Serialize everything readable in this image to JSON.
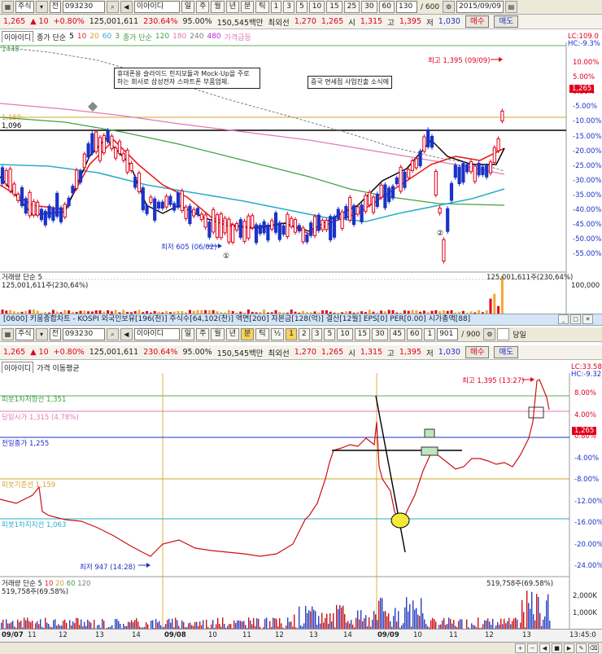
{
  "top_toolbar": {
    "market": "주식",
    "market_type": "전",
    "code": "093230",
    "name": "이아이디",
    "periods": [
      "일",
      "주",
      "월",
      "년",
      "분",
      "틱"
    ],
    "minute_buttons": [
      "1",
      "3",
      "5",
      "10",
      "15",
      "25",
      "30",
      "60"
    ],
    "count": "130",
    "total": "/ 600",
    "date": "2015/09/09"
  },
  "quote": {
    "price": "1,265",
    "change": "▲ 10",
    "change_pct": "+0.80%",
    "volume": "125,001,611",
    "vol_ratio": "230.64%",
    "pct95": "95.00%",
    "amount": "150,545백만",
    "ma_label": "최외선",
    "v1": "1,270",
    "v2": "1,265",
    "open_label": "시",
    "open": "1,315",
    "high_label": "고",
    "high": "1,395",
    "low_label": "저",
    "low": "1,030",
    "buy_label": "매수",
    "sell_label": "매도"
  },
  "top_chart": {
    "legend": {
      "name": "이아이디",
      "ma_label": "종가 단순",
      "ma_vals": [
        "5",
        "10",
        "20",
        "60",
        "3"
      ],
      "ma2_label": "종가 단순",
      "ma2_vals": [
        "120",
        "180",
        "240",
        "480"
      ],
      "extra": "가격급등"
    },
    "ma_colors": [
      "#000000",
      "#e82121",
      "#d9c12a",
      "#3fa23f",
      "#2aaec9",
      "#b72ad9",
      "#e07ab5",
      "#7d7d7d"
    ],
    "left_labels": [
      "1448",
      "1,159",
      "1,096"
    ],
    "notes": {
      "note1": "휴대폰용 슬라이드 힌지모듈과 Mock-Up을 주로 하는 회사로 삼성전자 스마트폰 부품업체.",
      "note2": "중국 면세점 사업진출 소식에"
    },
    "high_label": "최고 1,395 (09/09)",
    "low_label": "최저 605 (06/02)",
    "marker1": "①",
    "marker2": "②",
    "axis_header": "LC:109.0",
    "axis_header2": "HC:-9.3%",
    "axis_pct": [
      "10.00%",
      "5.00%",
      "0.80%",
      "-5.00%",
      "-10.00%",
      "-15.00%",
      "-20.00%",
      "-25.00%",
      "-30.00%",
      "-35.00%",
      "-40.00%",
      "-45.00%",
      "-50.00%",
      "-55.00%"
    ],
    "price_tag": "1,265",
    "vol_legend": "거래량 단순 5",
    "vol_value": "125,001,611주(230,64%)",
    "vol_value_right": "125,001,611주(230,64%)",
    "vol_axis": "100,000"
  },
  "panel_title": "[0600] 키움종합차트 - KOSPI 외국인보유[196(천)] 주식수[64,102(천)] 액면[200] 자본금[128(억)] 결산[12월] EPS[0] PER[0.00] 시가총액[88]",
  "second_toolbar": {
    "market": "주식",
    "market_type": "전",
    "code": "093230",
    "name": "이아이디",
    "periods": [
      "일",
      "주",
      "월",
      "년",
      "분",
      "틱"
    ],
    "minute_buttons": [
      "1",
      "2",
      "3",
      "5",
      "10",
      "15",
      "30",
      "45",
      "60",
      "1"
    ],
    "count": "901",
    "total": "/ 900",
    "checkbox_label": "당일"
  },
  "bottom_chart": {
    "legend": {
      "name": "이아이디",
      "indicator": "가격 이동평균"
    },
    "levels": {
      "r1": "피봇1차저항선 1,351",
      "open": "당일시가 1,315 (4.78%)",
      "prev_close": "전일종가 1,255",
      "base": "피봇기준선 1,159",
      "s1": "피봇1차지지선 1,063"
    },
    "high_label": "최고 1,395 (13:27)",
    "low_label": "최저 947 (14:28)",
    "axis_header": "LC:33.58",
    "axis_header2": "HC:-9.32",
    "axis_pct": [
      "8.00%",
      "4.00%",
      "0.80%",
      "-4.00%",
      "-8.00%",
      "-12.00%",
      "-16.00%",
      "-20.00%",
      "-24.00%"
    ],
    "price_tag": "1,265",
    "vol_legend": "거래량 단순 5",
    "vol_ma_vals": [
      "10",
      "20",
      "60",
      "120"
    ],
    "vol_value": "519,758주(69.58%)",
    "vol_value_right": "519,758주(69.58%)",
    "vol_axis": [
      "2,000K",
      "1,000K"
    ]
  },
  "date_axis": [
    "09/07",
    "11",
    "12",
    "13",
    "14",
    "09/08",
    "10",
    "11",
    "12",
    "13",
    "14",
    "09/09",
    "10",
    "11",
    "12",
    "13"
  ],
  "time_right": "13:45:0"
}
